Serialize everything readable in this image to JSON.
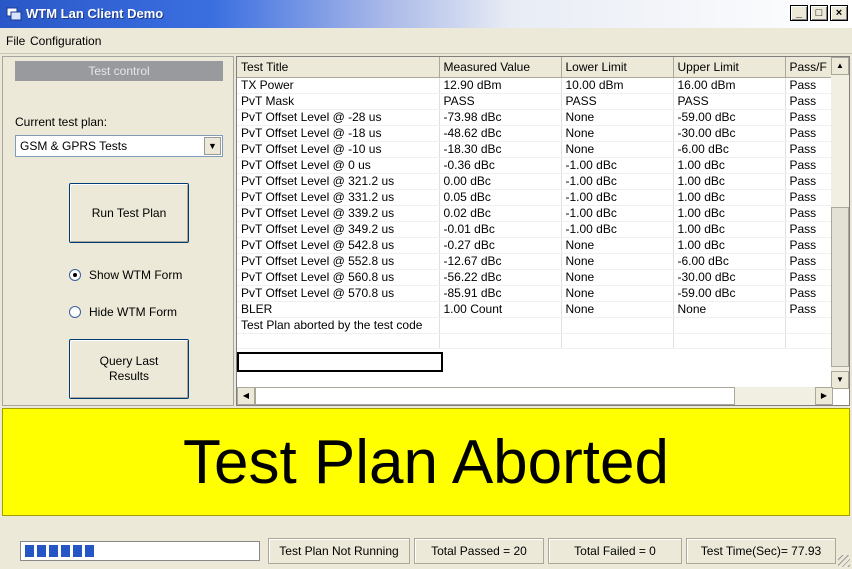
{
  "window": {
    "title": "WTM Lan Client Demo",
    "controls": [
      "_",
      "□",
      "×"
    ]
  },
  "menu": [
    "File",
    "Configuration"
  ],
  "left_panel": {
    "header": "Test control",
    "plan_label": "Current test plan:",
    "plan_value": "GSM & GPRS Tests",
    "run_button": "Run Test Plan",
    "show_form": "Show WTM Form",
    "hide_form": "Hide WTM Form",
    "selected_form_option": "Show WTM Form",
    "query_button_line1": "Query Last",
    "query_button_line2": "Results"
  },
  "grid": {
    "columns": [
      "Test Title",
      "Measured Value",
      "Lower Limit",
      "Upper Limit",
      "Pass/F"
    ],
    "rows": [
      [
        "TX Power",
        "12.90 dBm",
        "10.00 dBm",
        "16.00 dBm",
        "Pass"
      ],
      [
        "PvT Mask",
        "PASS",
        "PASS",
        "PASS",
        "Pass"
      ],
      [
        "PvT Offset Level @ -28 us",
        "-73.98 dBc",
        "None",
        "-59.00 dBc",
        "Pass"
      ],
      [
        "PvT Offset Level @ -18 us",
        "-48.62 dBc",
        "None",
        "-30.00 dBc",
        "Pass"
      ],
      [
        "PvT Offset Level @ -10 us",
        "-18.30 dBc",
        "None",
        "-6.00 dBc",
        "Pass"
      ],
      [
        "PvT Offset Level @ 0 us",
        "-0.36 dBc",
        "-1.00 dBc",
        "1.00 dBc",
        "Pass"
      ],
      [
        "PvT Offset Level @ 321.2 us",
        "0.00 dBc",
        "-1.00 dBc",
        "1.00 dBc",
        "Pass"
      ],
      [
        "PvT Offset Level @ 331.2 us",
        "0.05 dBc",
        "-1.00 dBc",
        "1.00 dBc",
        "Pass"
      ],
      [
        "PvT Offset Level @ 339.2 us",
        "0.02 dBc",
        "-1.00 dBc",
        "1.00 dBc",
        "Pass"
      ],
      [
        "PvT Offset Level @ 349.2 us",
        "-0.01 dBc",
        "-1.00 dBc",
        "1.00 dBc",
        "Pass"
      ],
      [
        "PvT Offset Level @ 542.8 us",
        "-0.27 dBc",
        "None",
        "1.00 dBc",
        "Pass"
      ],
      [
        "PvT Offset Level @ 552.8 us",
        "-12.67 dBc",
        "None",
        "-6.00 dBc",
        "Pass"
      ],
      [
        "PvT Offset Level @ 560.8 us",
        "-56.22 dBc",
        "None",
        "-30.00 dBc",
        "Pass"
      ],
      [
        "PvT Offset Level @ 570.8 us",
        "-85.91 dBc",
        "None",
        "-59.00 dBc",
        "Pass"
      ],
      [
        "BLER",
        "1.00 Count",
        "None",
        "None",
        "Pass"
      ],
      [
        "Test Plan aborted by the test code",
        "",
        "",
        "",
        ""
      ]
    ]
  },
  "banner": "Test Plan Aborted",
  "status": {
    "progress": 0.3,
    "state": "Test Plan Not Running",
    "passed": "Total Passed = 20",
    "failed": "Total Failed = 0",
    "time": "Test Time(Sec)= 77.93"
  }
}
